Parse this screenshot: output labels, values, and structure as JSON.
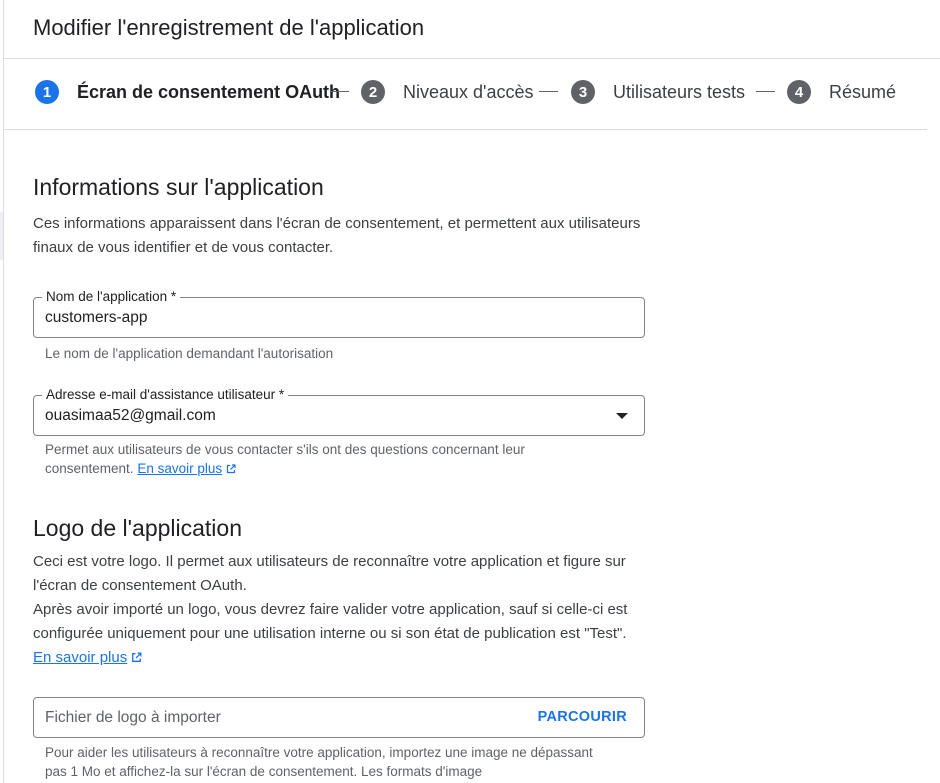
{
  "header": {
    "title": "Modifier l'enregistrement de l'application"
  },
  "stepper": {
    "steps": [
      {
        "number": "1",
        "label": "Écran de consentement OAuth",
        "active": true
      },
      {
        "number": "2",
        "label": "Niveaux d'accès",
        "active": false
      },
      {
        "number": "3",
        "label": "Utilisateurs tests",
        "active": false
      },
      {
        "number": "4",
        "label": "Résumé",
        "active": false
      }
    ]
  },
  "app_info": {
    "heading": "Informations sur l'application",
    "description": "Ces informations apparaissent dans l'écran de consentement, et permettent aux utilisateurs finaux de vous identifier et de vous contacter.",
    "app_name": {
      "label": "Nom de l'application *",
      "value": "customers-app",
      "hint": "Le nom de l'application demandant l'autorisation"
    },
    "support_email": {
      "label": "Adresse e-mail d'assistance utilisateur *",
      "value": "ouasimaa52@gmail.com",
      "hint": "Permet aux utilisateurs de vous contacter s'ils ont des questions concernant leur consentement.",
      "learn_more": "En savoir plus"
    }
  },
  "logo": {
    "heading": "Logo de l'application",
    "description_1": "Ceci est votre logo. Il permet aux utilisateurs de reconnaître votre application et figure sur l'écran de consentement OAuth.",
    "description_2": "Après avoir importé un logo, vous devrez faire valider votre application, sauf si celle-ci est configurée uniquement pour une utilisation interne ou si son état de publication est \"Test\".",
    "learn_more": "En savoir plus",
    "file_field": {
      "placeholder": "Fichier de logo à importer",
      "browse_label": "PARCOURIR"
    },
    "hint": "Pour aider les utilisateurs à reconnaître votre application, importez une image ne dépassant pas 1 Mo et affichez-la sur l'écran de consentement. Les formats d'image"
  },
  "colors": {
    "accent": "#1a73e8",
    "inactive_step": "#5f6368",
    "border": "#80868b",
    "divider": "#dadce0"
  },
  "icons": {
    "external_link": "open-in-new-icon",
    "dropdown": "arrow-drop-down-icon"
  }
}
